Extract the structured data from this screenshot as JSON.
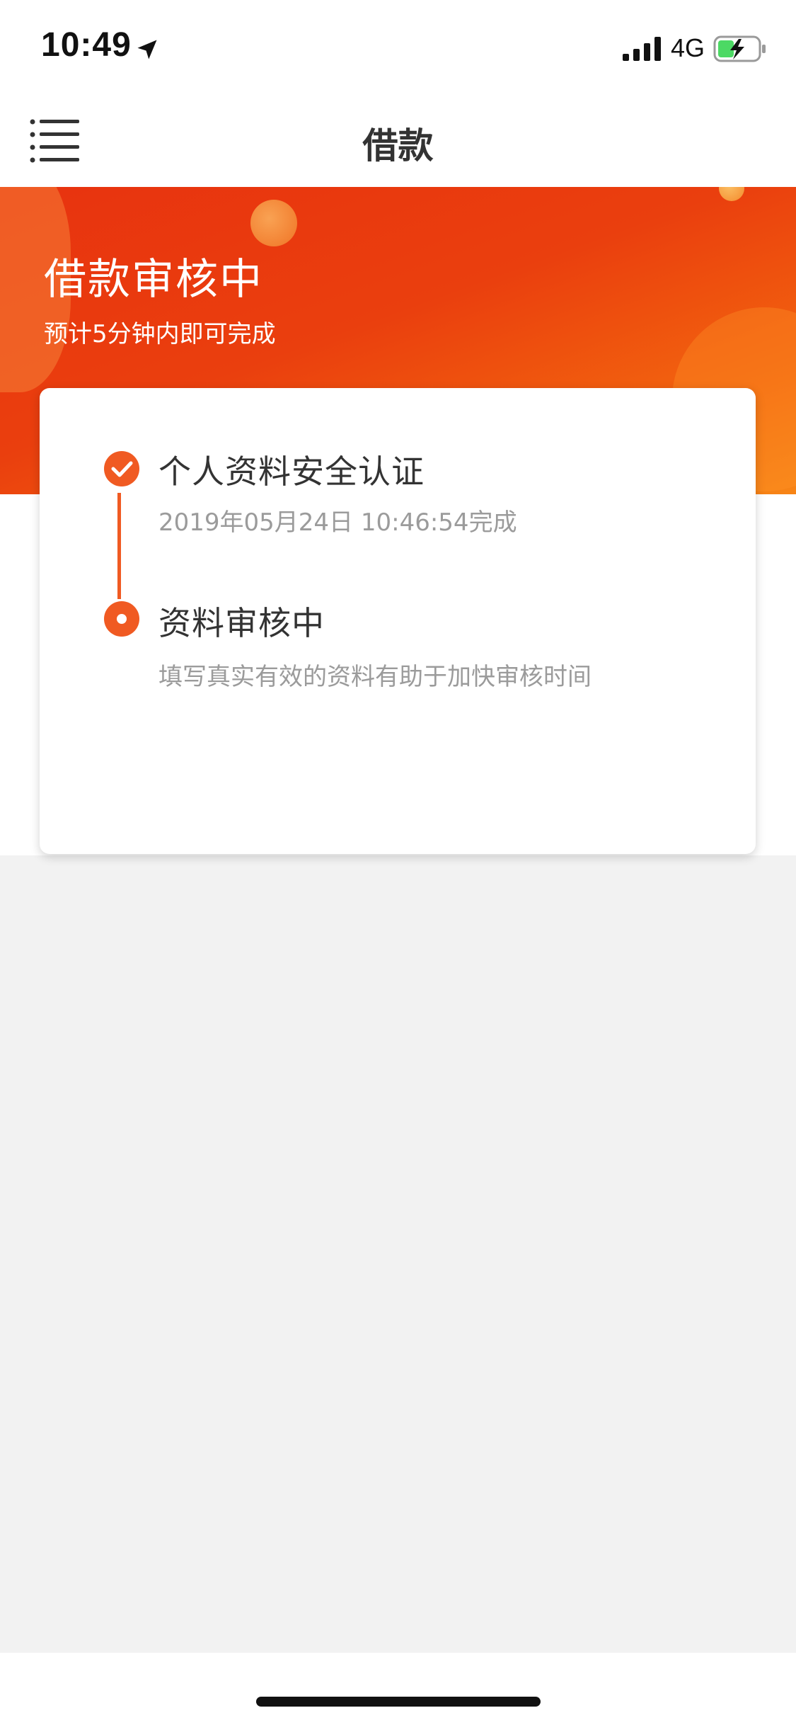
{
  "status_bar": {
    "time": "10:49",
    "network": "4G",
    "icons": [
      "location-arrow-icon",
      "signal-icon",
      "battery-charging-icon"
    ]
  },
  "nav": {
    "title": "借款",
    "menu_icon": "menu-list-icon"
  },
  "hero": {
    "title": "借款审核中",
    "subtitle": "预计5分钟内即可完成"
  },
  "steps": [
    {
      "title": "个人资料安全认证",
      "desc": "2019年05月24日 10:46:54完成",
      "status": "done",
      "icon": "checkmark-circle-icon"
    },
    {
      "title": "资料审核中",
      "desc": "填写真实有效的资料有助于加快审核时间",
      "status": "current",
      "icon": "current-dot-icon"
    }
  ],
  "colors": {
    "accent": "#F05A22",
    "hero_start": "#E8330F",
    "hero_end": "#F78516",
    "muted_text": "#9B9B9B",
    "background": "#F2F2F2"
  }
}
